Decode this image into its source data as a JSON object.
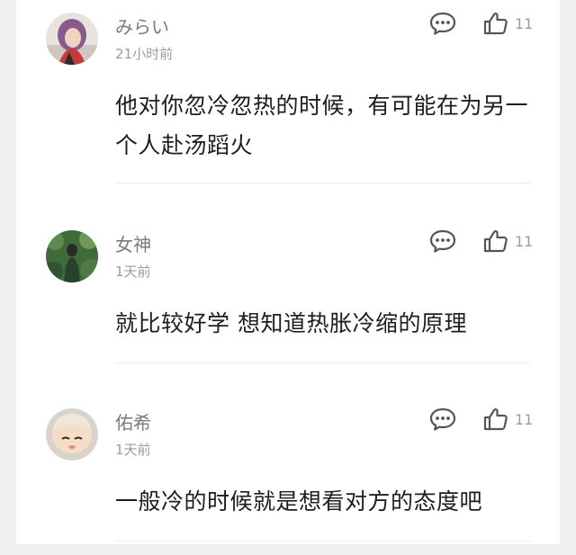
{
  "comments": [
    {
      "username": "みらい",
      "time": "21小时前",
      "likes": "11",
      "text": "他对你忽冷忽热的时候，有可能在为另一个人赴汤蹈火",
      "avatar_icon": "avatar-girl-purple-hair"
    },
    {
      "username": "女神",
      "time": "1天前",
      "likes": "11",
      "text": "就比较好学 想知道热胀冷缩的原理",
      "avatar_icon": "avatar-green-foliage"
    },
    {
      "username": "佑希",
      "time": "1天前",
      "likes": "11",
      "text": "一般冷的时候就是想看对方的态度吧",
      "avatar_icon": "avatar-child-face"
    }
  ],
  "icons": {
    "reply": "comment-bubble-icon",
    "like": "thumbs-up-icon"
  },
  "colors": {
    "username": "#7b7b7b",
    "meta": "#9c9c9c",
    "text": "#1e1e1e",
    "divider": "#ececec",
    "page_edge": "#f0f0f0"
  }
}
